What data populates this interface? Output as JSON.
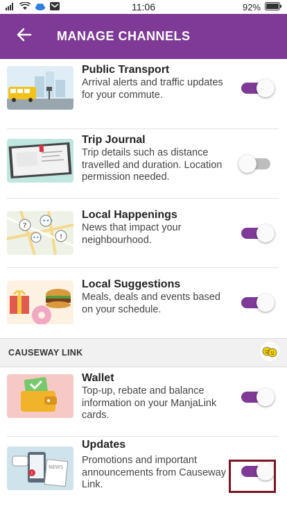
{
  "status_bar": {
    "time": "11:06",
    "battery": "92%"
  },
  "header": {
    "title": "MANAGE CHANNELS"
  },
  "channels_top": [
    {
      "title": "Public Transport",
      "description": "Arrival alerts and traffic updates for your commute.",
      "enabled": true
    },
    {
      "title": "Trip Journal",
      "description": "Trip details such as distance travelled and duration. Location permission needed.",
      "enabled": false
    },
    {
      "title": "Local Happenings",
      "description": "News that impact your neighbourhood.",
      "enabled": true
    },
    {
      "title": "Local Suggestions",
      "description": "Meals, deals and events based on your schedule.",
      "enabled": true
    }
  ],
  "section": {
    "title": "CAUSEWAY LINK"
  },
  "channels_section": [
    {
      "title": "Wallet",
      "description": "Top-up, rebate and balance information on your ManjaLink cards.",
      "enabled": true
    },
    {
      "title": "Updates",
      "description": "Promotions and important announcements from Causeway Link.",
      "enabled": true
    }
  ],
  "colors": {
    "accent": "#7e3a96",
    "highlight": "#7a1524"
  }
}
